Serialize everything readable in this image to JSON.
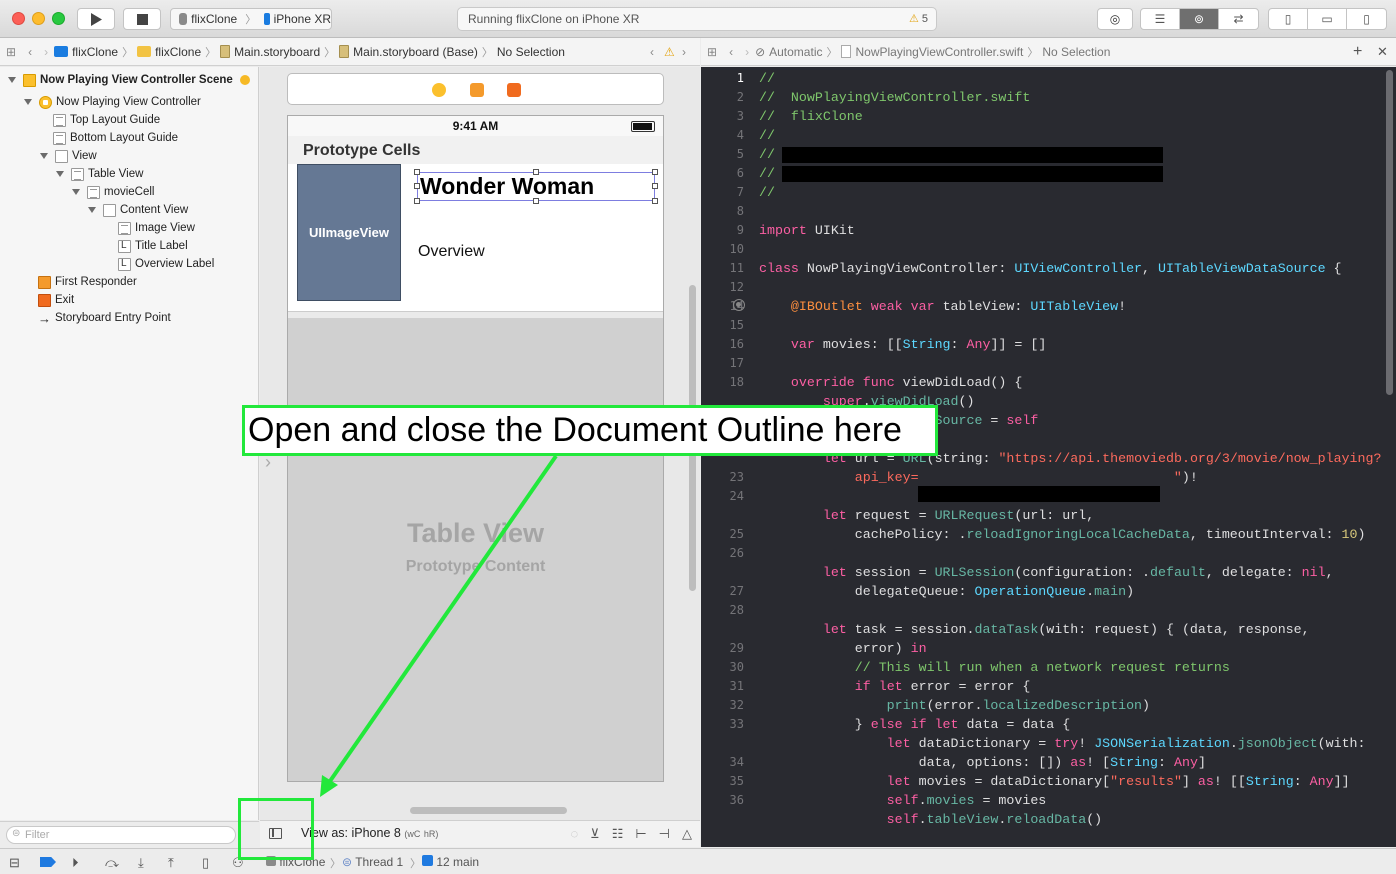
{
  "toolbar": {
    "scheme_project": "flixClone",
    "scheme_device": "iPhone XR",
    "status_text": "Running flixClone on iPhone XR",
    "warning_count": "5"
  },
  "left_jumpbar": {
    "crumbs": [
      "flixClone",
      "flixClone",
      "Main.storyboard",
      "Main.storyboard (Base)",
      "No Selection"
    ]
  },
  "right_jumpbar": {
    "crumbs": [
      "Automatic",
      "NowPlayingViewController.swift",
      "No Selection"
    ]
  },
  "outline": {
    "items": [
      {
        "label": "Now Playing View Controller Scene"
      },
      {
        "label": "Now Playing View Controller"
      },
      {
        "label": "Top Layout Guide"
      },
      {
        "label": "Bottom Layout Guide"
      },
      {
        "label": "View"
      },
      {
        "label": "Table View"
      },
      {
        "label": "movieCell"
      },
      {
        "label": "Content View"
      },
      {
        "label": "Image View"
      },
      {
        "label": "Title Label"
      },
      {
        "label": "Overview Label"
      },
      {
        "label": "First Responder"
      },
      {
        "label": "Exit"
      },
      {
        "label": "Storyboard Entry Point"
      }
    ],
    "filter_placeholder": "Filter"
  },
  "canvas": {
    "time": "9:41 AM",
    "prototype_header": "Prototype Cells",
    "image_view_label": "UIImageView",
    "title_label": "Wonder Woman",
    "overview_label": "Overview",
    "table_view_title": "Table View",
    "table_view_subtitle": "Prototype Content",
    "view_as": "View as: iPhone 8",
    "size_class_w": "wC",
    "size_class_h": "hR"
  },
  "editor": {
    "line_numbers": [
      "1",
      "2",
      "3",
      "4",
      "5",
      "6",
      "7",
      "8",
      "9",
      "10",
      "11",
      "12",
      "14",
      "15",
      "16",
      "17",
      "18",
      "",
      "21",
      "22",
      "",
      "23",
      "24",
      "",
      "25",
      "26",
      "",
      "27",
      "28",
      "",
      "29",
      "30",
      "31",
      "32",
      "33",
      "",
      "34",
      "35",
      "36"
    ],
    "current_line": "1"
  },
  "debugbar": {
    "target": "flixClone",
    "thread": "Thread 1",
    "frame": "12 main"
  },
  "annotation": {
    "callout_text": "Open and close the Document Outline here"
  }
}
